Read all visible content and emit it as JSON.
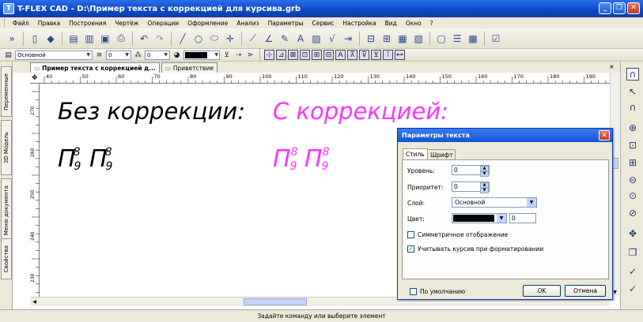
{
  "window": {
    "title": "T-FLEX CAD - D:\\Пример текста с коррекцией для курсива.grb",
    "minimize": "_",
    "restore": "❐",
    "close": "✕"
  },
  "menu": [
    "Файл",
    "Правка",
    "Построения",
    "Чертёж",
    "Операции",
    "Оформление",
    "Анализ",
    "Параметры",
    "Сервис",
    "Настройка",
    "Вид",
    "Окно",
    "?"
  ],
  "toolbar2": {
    "layer": "Основной",
    "level_value": "0",
    "priority_value": "0"
  },
  "tabs": [
    {
      "label": "Пример текста с коррекцией д..."
    },
    {
      "label": "Приветствие"
    }
  ],
  "tab_close": "×",
  "left_panel": [
    "Переменные",
    "3D Модель",
    "Меню документа",
    "Свойства"
  ],
  "ruler": {
    "h_ticks": [
      "40",
      "50",
      "60",
      "70",
      "80",
      "90",
      "100",
      "110",
      "120",
      "130",
      "140",
      "150",
      "160",
      "170",
      "180",
      "190"
    ],
    "v_ticks": [
      "270",
      "260",
      "250",
      "240",
      "230"
    ]
  },
  "drawing": {
    "text_no_correction": "Без коррекции:",
    "text_with_correction": "С коррекцией:",
    "sample_base": "П",
    "sample_sup": "8",
    "sample_sub": "9",
    "color_left": "#000000",
    "color_right": "#ff33ff"
  },
  "dialog": {
    "title": "Параметры текста",
    "close": "✕",
    "tabs": [
      "Стиль",
      "Шрифт"
    ],
    "level_label": "Уровень:",
    "level_value": "0",
    "priority_label": "Приоритет:",
    "priority_value": "0",
    "layer_label": "Слой:",
    "layer_value": "Основной",
    "color_label": "Цвет:",
    "color_value": "0",
    "symmetric_label": "Симметричное отображение",
    "symmetric_checked": false,
    "italic_label": "Учитывать курсив при форматировании",
    "italic_checked": true,
    "default_label": "По умолчанию",
    "default_checked": false,
    "ok": "OK",
    "cancel": "Отмена"
  },
  "status": "Задайте команду или выберите элемент"
}
